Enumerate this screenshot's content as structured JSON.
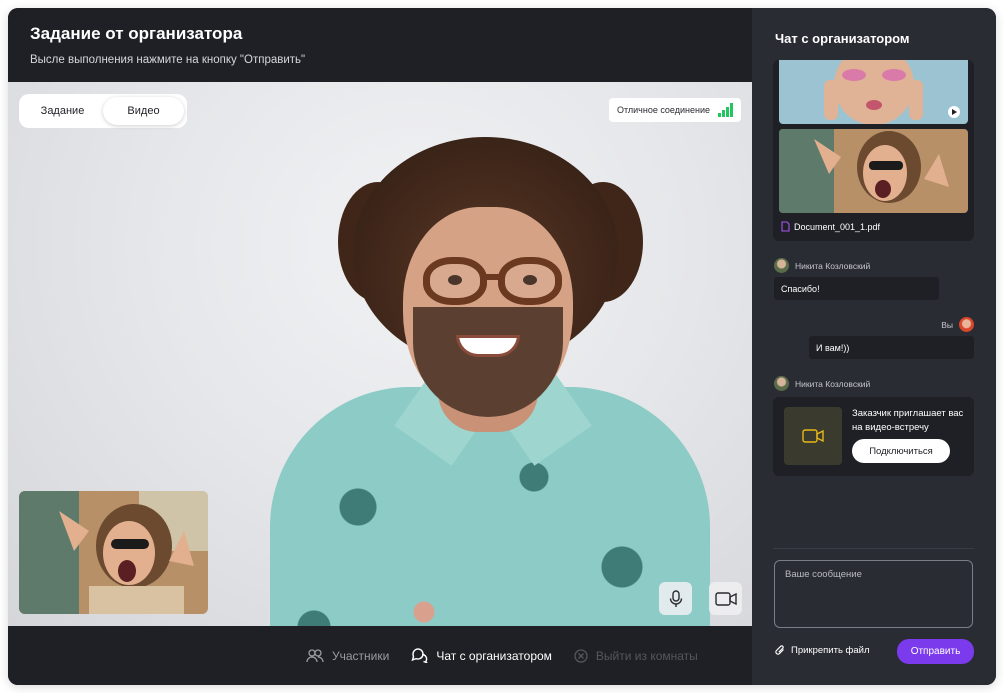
{
  "header": {
    "title": "Задание от организатора",
    "subtitle": "Выcле выполнения нажмите на кнопку \"Отправить\""
  },
  "video": {
    "tabs": [
      {
        "label": "Задание",
        "active": false
      },
      {
        "label": "Видео",
        "active": true
      }
    ],
    "connection_label": "Отличное соединение",
    "icons": {
      "mic": "microphone-icon",
      "camera": "video-camera-icon",
      "signal": "signal-bars-icon"
    }
  },
  "bottombar": {
    "participants": "Участники",
    "chat": "Чат с организатором",
    "leave": "Выйти из комнаты"
  },
  "chat": {
    "title": "Чат с организатором",
    "attachment_file": "Document_001_1.pdf",
    "messages": [
      {
        "author": "Никита Козловский",
        "text": "Спасибо!"
      },
      {
        "author": "Вы",
        "text": "И вам!))"
      },
      {
        "author": "Никита Козловский",
        "invite_text": "Заказчик приглашает вас на видео-встречу",
        "button": "Подключиться"
      }
    ],
    "input_placeholder": "Ваше сообщение",
    "attach_label": "Прикрепить файл",
    "send_label": "Отправить"
  },
  "colors": {
    "accent": "#7c3aed",
    "signal": "#22c55e",
    "panel": "#2a2c34",
    "background": "#1f2025",
    "video_icon": "#e8b81a"
  }
}
